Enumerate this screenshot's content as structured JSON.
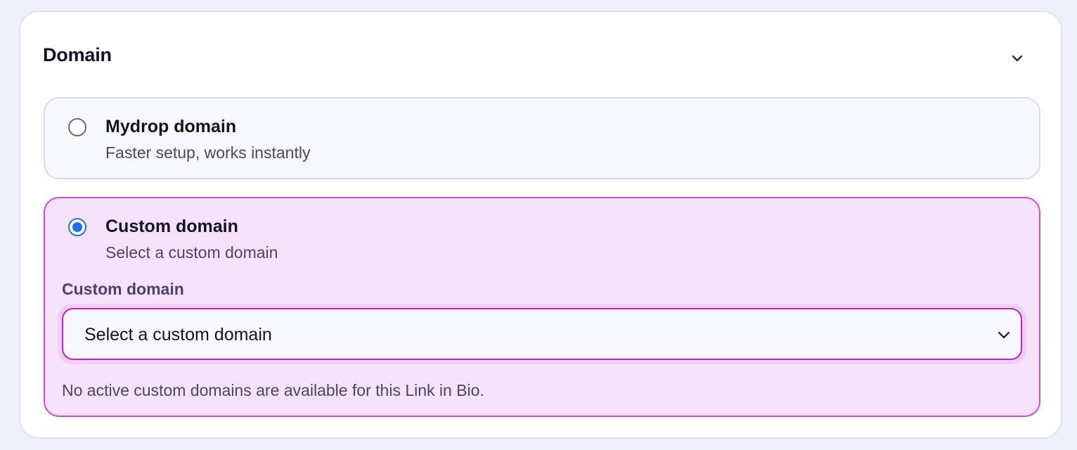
{
  "section": {
    "title": "Domain",
    "collapse_icon": "chevron-down-icon"
  },
  "options": [
    {
      "title": "Mydrop domain",
      "description": "Faster setup, works instantly",
      "selected": false
    },
    {
      "title": "Custom domain",
      "description": "Select a custom domain",
      "selected": true
    }
  ],
  "custom_domain_field": {
    "label": "Custom domain",
    "selected_value": "Select a custom domain",
    "dropdown_icon": "chevron-down-icon",
    "help_text": "No active custom domains are available for this Link in Bio."
  },
  "colors": {
    "page_background": "#eef0fc",
    "card_background": "#ffffff",
    "selected_option_background": "#f6e2fb",
    "selected_option_border": "#c94bdc",
    "select_border": "#c21fcf",
    "radio_accent": "#1a73e8",
    "heading_text": "#141326",
    "muted_text": "#4a4470"
  }
}
